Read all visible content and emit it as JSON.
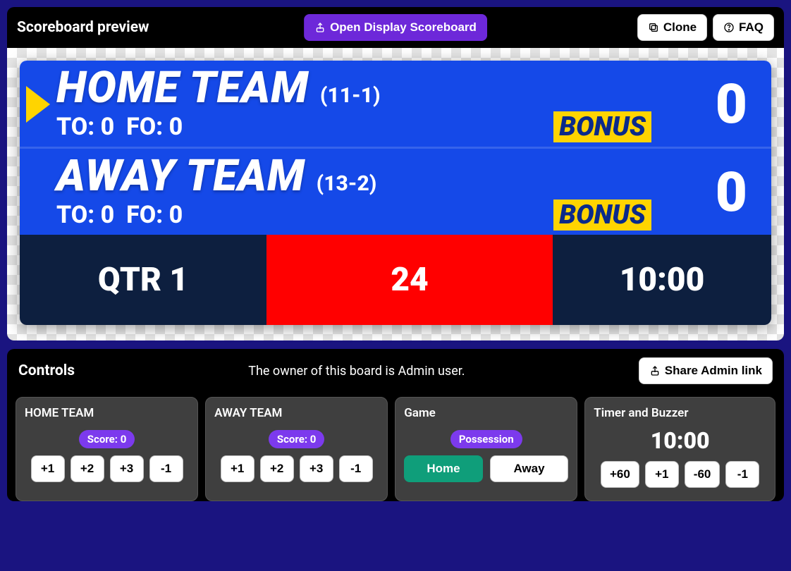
{
  "preview": {
    "title": "Scoreboard preview",
    "open_display_label": "Open Display Scoreboard",
    "clone_label": "Clone",
    "faq_label": "FAQ"
  },
  "board": {
    "home": {
      "name": "HOME TEAM",
      "record": "(11-1)",
      "to_label": "TO: 0",
      "fo_label": "FO: 0",
      "bonus": "BONUS",
      "score": "0",
      "possession": true
    },
    "away": {
      "name": "AWAY TEAM",
      "record": "(13-2)",
      "to_label": "TO: 0",
      "fo_label": "FO: 0",
      "bonus": "BONUS",
      "score": "0",
      "possession": false
    },
    "period_label": "QTR 1",
    "shot_clock": "24",
    "game_clock": "10:00"
  },
  "controls": {
    "title": "Controls",
    "owner_text": "The owner of this board is Admin user.",
    "share_label": "Share Admin link",
    "cards": {
      "home": {
        "title": "HOME TEAM",
        "score_label": "Score: 0",
        "buttons": [
          "+1",
          "+2",
          "+3",
          "-1"
        ]
      },
      "away": {
        "title": "AWAY TEAM",
        "score_label": "Score: 0",
        "buttons": [
          "+1",
          "+2",
          "+3",
          "-1"
        ]
      },
      "game": {
        "title": "Game",
        "possession_label": "Possession",
        "home_label": "Home",
        "away_label": "Away",
        "active": "home"
      },
      "timer": {
        "title": "Timer and Buzzer",
        "clock": "10:00",
        "buttons": [
          "+60",
          "+1",
          "-60",
          "-1"
        ]
      }
    }
  }
}
